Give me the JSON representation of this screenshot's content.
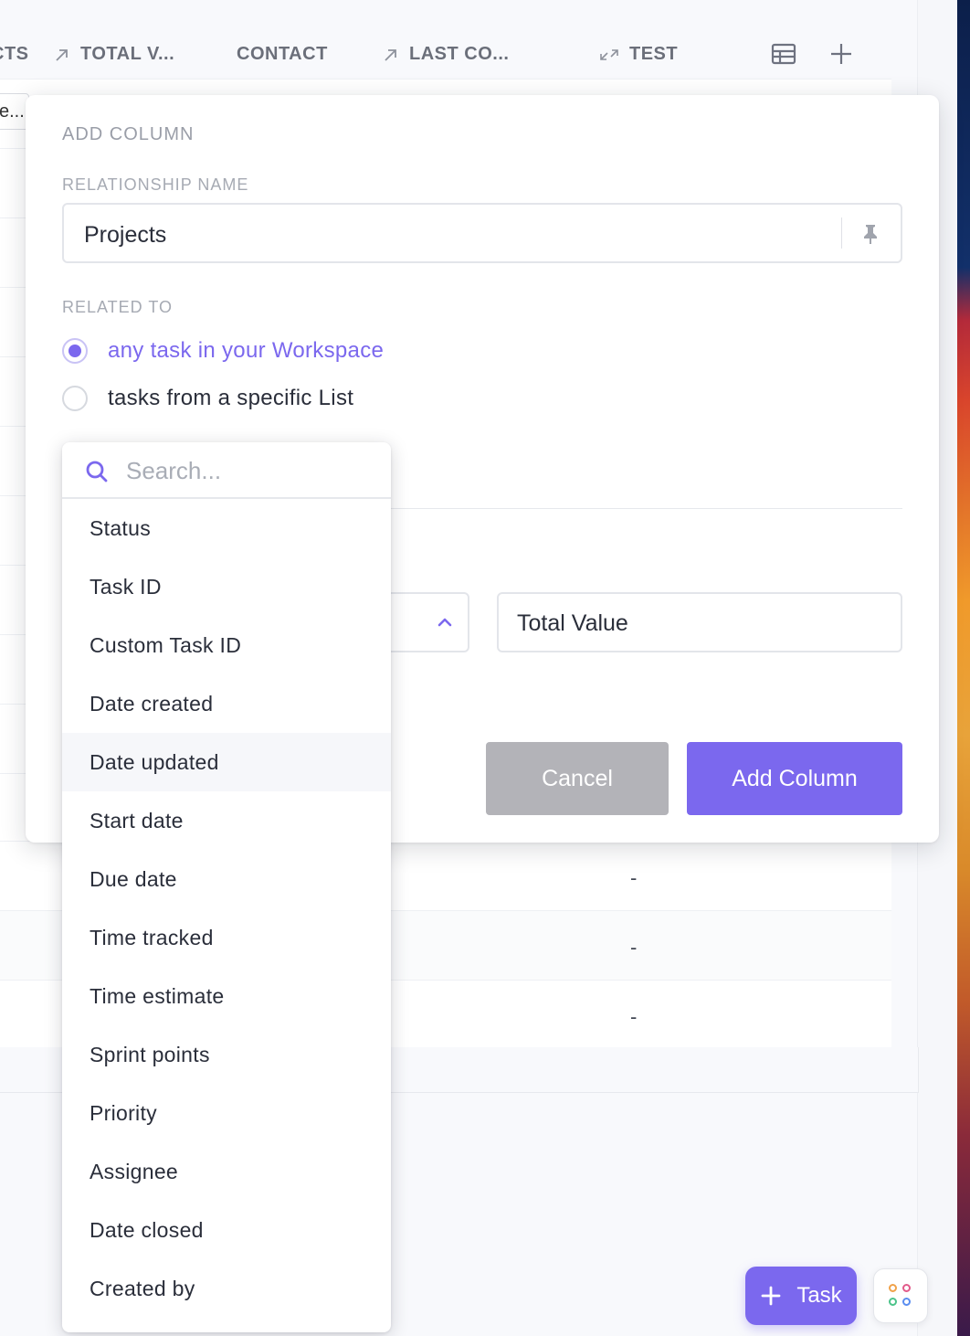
{
  "table": {
    "columns": [
      {
        "label": "CTS",
        "icon": "none"
      },
      {
        "label": "TOTAL V...",
        "icon": "arrow-up-right-icon"
      },
      {
        "label": "CONTACT",
        "icon": "none"
      },
      {
        "label": "LAST CO...",
        "icon": "arrow-up-right-icon"
      },
      {
        "label": "TEST",
        "icon": "bidirectional-arrow-icon"
      }
    ],
    "partial_cell": "e...",
    "dash_values": [
      "-",
      "-",
      "-"
    ]
  },
  "modal": {
    "title": "ADD COLUMN",
    "relationship_label": "RELATIONSHIP NAME",
    "relationship_value": "Projects",
    "related_to_label": "RELATED TO",
    "options": [
      {
        "label": "any task in your Workspace",
        "checked": true
      },
      {
        "label": "tasks from a specific List",
        "checked": false
      }
    ],
    "column_name_value": "Total Value",
    "cancel_label": "Cancel",
    "add_label": "Add Column"
  },
  "dropdown": {
    "search_placeholder": "Search...",
    "items": [
      "Status",
      "Task ID",
      "Custom Task ID",
      "Date created",
      "Date updated",
      "Start date",
      "Due date",
      "Time tracked",
      "Time estimate",
      "Sprint points",
      "Priority",
      "Assignee",
      "Date closed",
      "Created by"
    ],
    "hovered": "Date updated"
  },
  "fab": {
    "label": "Task"
  },
  "colors": {
    "accent": "#7b68ee",
    "cancel": "#b3b3b8"
  }
}
